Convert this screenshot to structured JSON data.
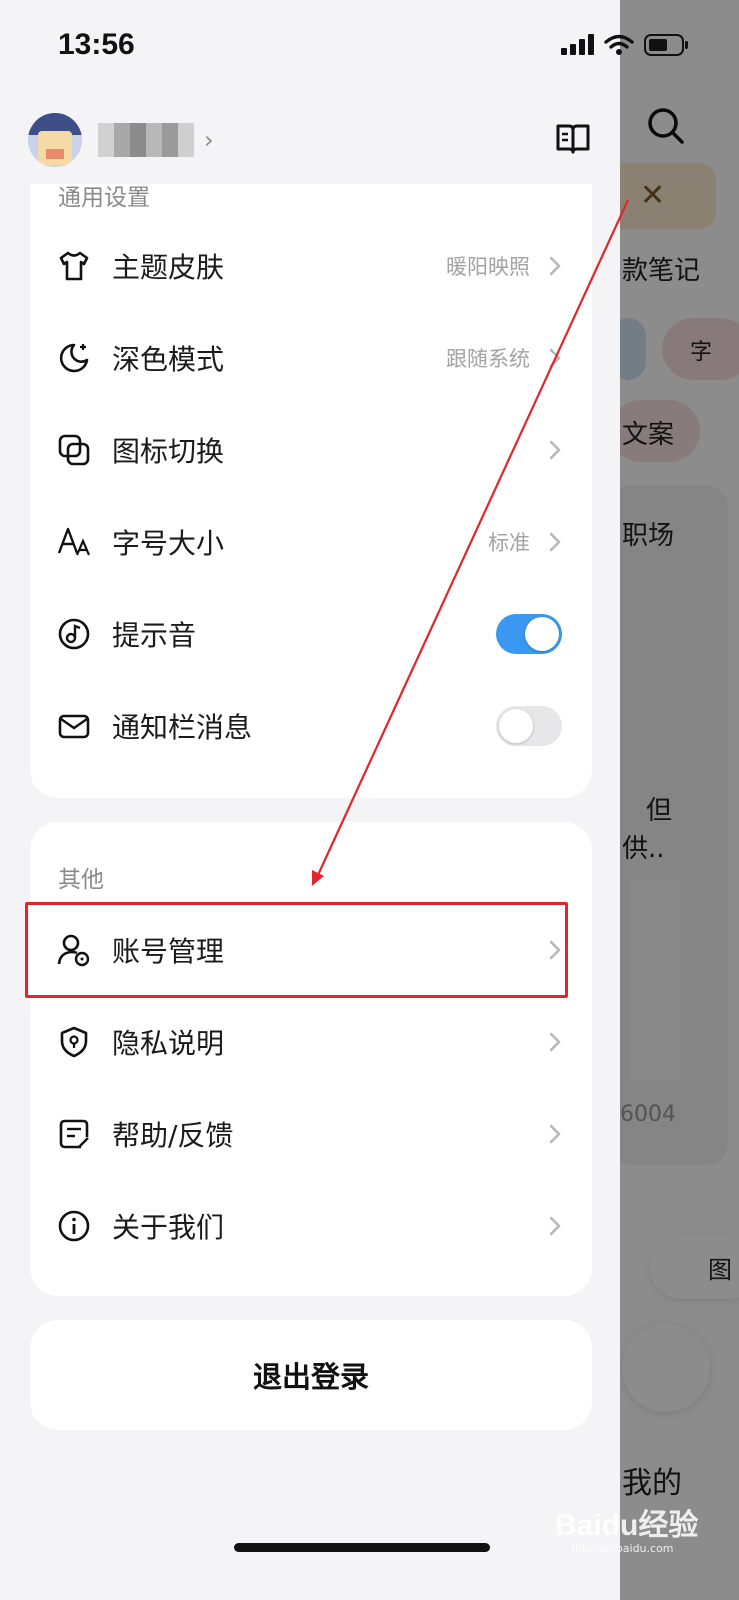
{
  "status_bar": {
    "time": "13:56"
  },
  "profile": {
    "arrow": "›"
  },
  "general": {
    "section_title": "通用设置",
    "items": [
      {
        "label": "主题皮肤",
        "value": "暖阳映照",
        "icon": "tshirt-icon"
      },
      {
        "label": "深色模式",
        "value": "跟随系统",
        "icon": "moon-icon"
      },
      {
        "label": "图标切换",
        "value": "",
        "icon": "icon-switch-icon"
      },
      {
        "label": "字号大小",
        "value": "标准",
        "icon": "font-size-icon"
      },
      {
        "label": "提示音",
        "toggle": true,
        "icon": "music-note-icon"
      },
      {
        "label": "通知栏消息",
        "toggle": false,
        "icon": "mail-icon"
      }
    ]
  },
  "other": {
    "section_title": "其他",
    "items": [
      {
        "label": "账号管理",
        "icon": "account-settings-icon"
      },
      {
        "label": "隐私说明",
        "icon": "privacy-shield-icon"
      },
      {
        "label": "帮助/反馈",
        "icon": "feedback-icon"
      },
      {
        "label": "关于我们",
        "icon": "info-icon"
      }
    ]
  },
  "logout_label": "退出登录",
  "background_app": {
    "text_1": "款笔记",
    "text_2": "文案",
    "text_3": "职场",
    "text_4": "但",
    "text_5": "供..",
    "text_6": "6004",
    "text_7": "我的",
    "chip_char": "字",
    "pill_text": "图"
  },
  "watermark": {
    "brand": "Baidu经验",
    "url": "jingyan.baidu.com"
  },
  "colors": {
    "accent": "#3a98f2",
    "highlight": "#e0262d"
  }
}
